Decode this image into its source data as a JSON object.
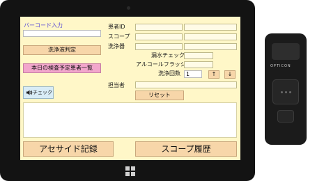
{
  "form": {
    "barcode_label": "バーコード入力",
    "wash_judge_button": "洗浄液判定",
    "today_patients_button": "本日の検査予定患者一覧",
    "sound_check_button": "チェック",
    "patient_id_label": "患者ID",
    "scope_label": "スコープ",
    "washer_label": "洗浄器",
    "leak_check_label": "漏水チェック",
    "alcohol_flush_label": "アルコールフラッシュ",
    "wash_count_label": "洗浄回数",
    "wash_count_value": "1",
    "up_arrow": "↑",
    "down_arrow": "↓",
    "staff_label": "担当者",
    "reset_button": "リセット",
    "acid_record_button": "アセサイド記録",
    "scope_history_button": "スコープ履歴"
  },
  "device": {
    "brand": "OPTICON"
  },
  "colors": {
    "screen_bg": "#fff7c8",
    "button_orange": "#f7d6a9",
    "button_pink": "#f2a6cc",
    "title_accent": "#5a4bd6"
  }
}
